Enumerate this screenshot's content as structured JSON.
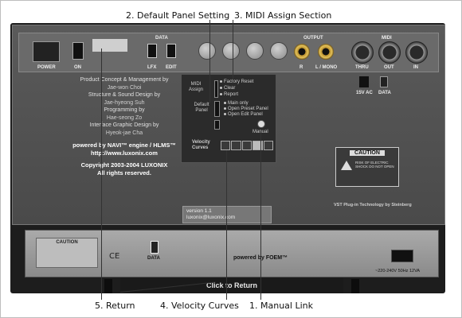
{
  "callouts": {
    "default_panel": "2. Default Panel Setting",
    "midi_assign": "3. MIDI Assign Section",
    "return": "5. Return",
    "velocity": "4. Velocity Curves",
    "manual": "1. Manual Link"
  },
  "connectors": {
    "power": "POWER",
    "on": "ON",
    "data": "DATA",
    "lfx": "LFX",
    "edit": "EDIT",
    "output": "OUTPUT",
    "r": "R",
    "lmono": "L / MONO",
    "midi": "MIDI",
    "thru": "THRU",
    "out": "OUT",
    "in": "IN",
    "ac": "15V AC",
    "data2": "DATA"
  },
  "credits": {
    "line1": "Product Concept & Management by",
    "line1b": "Jae-won Choi",
    "line2": "Structure & Sound Design by",
    "line2b": "Jae-hyeong Suh",
    "line3": "Programming by",
    "line3b": "Hae-seong Zo",
    "line4": "Interface Graphic Design by",
    "line4b": "Hyeok-jae Cha",
    "powered": "powered by NAVI™ engine / HLMS™",
    "url": "http://www.luxonix.com",
    "copyright": "Copyright 2003-2004 LUXONIX",
    "rights": "All rights reserved."
  },
  "controls": {
    "midi_assign": "MIDI Assign",
    "factory_reset": "Factory Reset",
    "clear": "Clear",
    "report": "Report",
    "default_panel": "Default Panel",
    "main_only": "Main only",
    "open_preset": "Open Preset Panel",
    "open_edit": "Open Edit Panel",
    "manual": "Manual",
    "velocity_curves": "Velocity Curves"
  },
  "version": {
    "line1": "version 1.1",
    "line2": "luxonix@luxonix.com"
  },
  "caution": {
    "title": "CAUTION",
    "sub": "RISK OF ELECTRIC SHOCK DO NOT OPEN"
  },
  "vst": "VST Plug-in Technology by Steinberg",
  "lower": {
    "caution": "CAUTION",
    "data": "DATA",
    "powered": "powered by FOEM™",
    "power_spec": "~220-240V 50Hz 12VA"
  },
  "return_label": "Click to Return"
}
